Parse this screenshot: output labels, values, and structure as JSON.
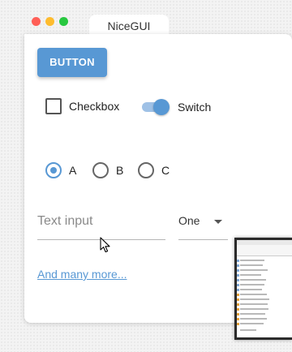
{
  "window": {
    "tab_title": "NiceGUI"
  },
  "controls": {
    "button_label": "BUTTON",
    "checkbox_label": "Checkbox",
    "switch_label": "Switch",
    "radios": [
      {
        "label": "A",
        "checked": true
      },
      {
        "label": "B",
        "checked": false
      },
      {
        "label": "C",
        "checked": false
      }
    ],
    "text_input_placeholder": "Text input",
    "text_input_value": "",
    "select_value": "One",
    "link_label": "And many more..."
  },
  "colors": {
    "accent": "#5898d4",
    "traffic_red": "#ff5f57",
    "traffic_yellow": "#febc2e",
    "traffic_green": "#28c840"
  },
  "icons": {
    "cursor": "arrow-pointer-icon",
    "select_caret": "caret-down-icon"
  }
}
